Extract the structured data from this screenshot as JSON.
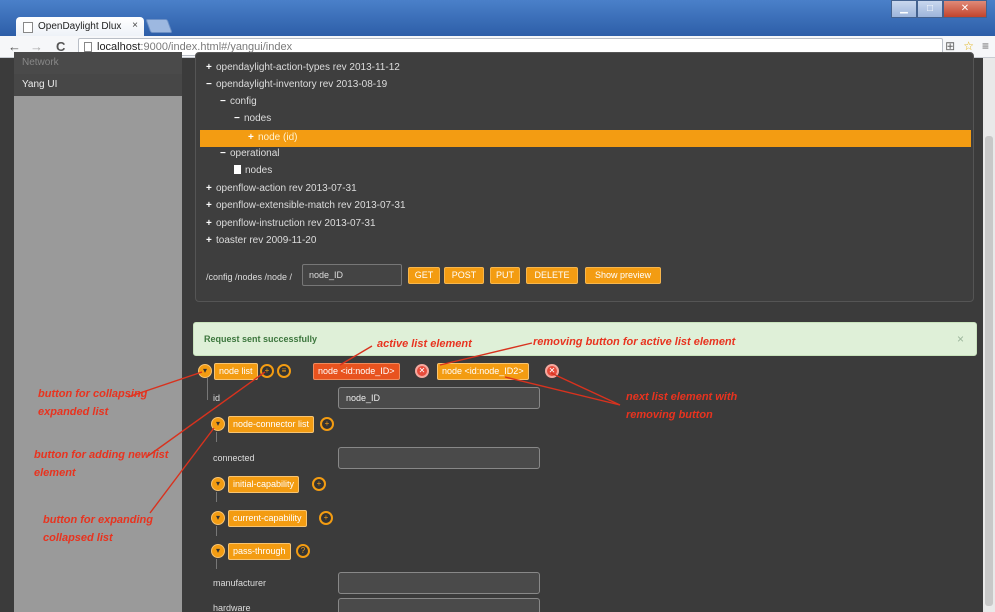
{
  "browser": {
    "tab_title": "OpenDaylight Dlux",
    "tab_close": "×",
    "url_host": "localhost",
    "url_rest": ":9000/index.html#/yangui/index",
    "nav_back": "←",
    "nav_forward": "→",
    "nav_reload": "C"
  },
  "sidebar": {
    "items": [
      {
        "label": "Network"
      },
      {
        "label": "Yang UI"
      }
    ]
  },
  "tree": {
    "rows": [
      {
        "sym": "+",
        "label": "opendaylight-action-types rev 2013-11-12"
      },
      {
        "sym": "−",
        "label": "opendaylight-inventory rev 2013-08-19"
      },
      {
        "sym": "−",
        "label": "config"
      },
      {
        "sym": "−",
        "label": "nodes"
      },
      {
        "sym": "+",
        "label": "node (id)"
      },
      {
        "sym": "−",
        "label": "operational"
      },
      {
        "sym": "",
        "label": "nodes"
      },
      {
        "sym": "+",
        "label": "openflow-action rev 2013-07-31"
      },
      {
        "sym": "+",
        "label": "openflow-extensible-match rev 2013-07-31"
      },
      {
        "sym": "+",
        "label": "openflow-instruction rev 2013-07-31"
      },
      {
        "sym": "+",
        "label": "toaster rev 2009-11-20"
      }
    ],
    "path_label": "/config /nodes /node /",
    "path_value": "node_ID",
    "buttons": [
      "GET",
      "POST",
      "PUT",
      "DELETE",
      "Show preview"
    ]
  },
  "alert": {
    "text": "Request sent successfully",
    "close": "×"
  },
  "form": {
    "node_list": "node list",
    "active_item": "node  <id:node_ID>",
    "next_item": "node  <id:node_ID2>",
    "id_label": "id",
    "id_value": "node_ID",
    "node_connector_list": "node-connector list",
    "connected_label": "connected",
    "initial_capability": "initial-capability",
    "current_capability": "current-capability",
    "pass_through": "pass-through",
    "manufacturer_label": "manufacturer",
    "hardware_label": "hardware"
  },
  "annotations": {
    "active": "active list element",
    "removing": "removing button for active list element",
    "next": "next list element with removing button",
    "collapse": "button for collapsing expanded list",
    "add": "button for adding new list element",
    "expand": "button for expanding collapsed list"
  },
  "colors": {
    "accent": "#f39c12",
    "active": "#e8531f",
    "annotation": "#e8331f",
    "success_bg": "#dff0d8"
  }
}
